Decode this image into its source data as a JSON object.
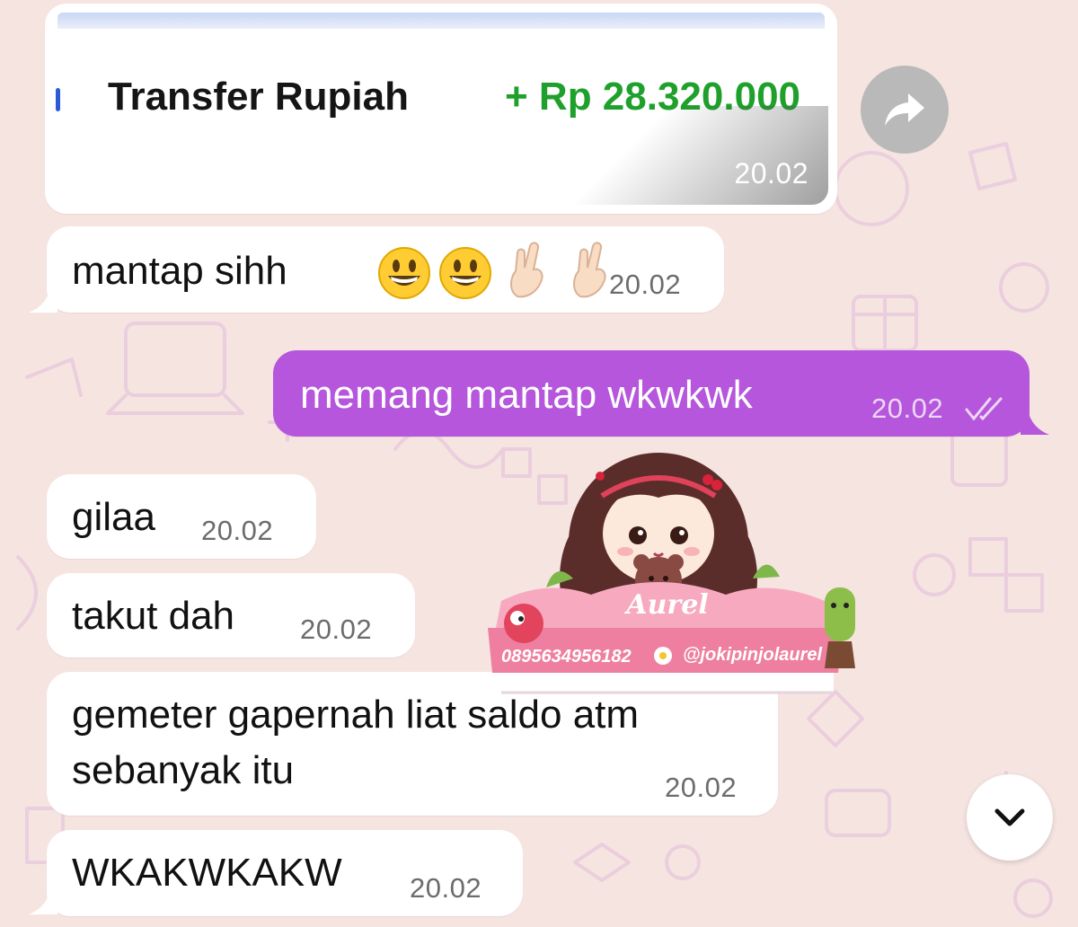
{
  "transfer_card": {
    "title": "Transfer Rupiah",
    "amount": "+ Rp 28.320.000",
    "time": "20.02",
    "amount_color": "#1fa02c"
  },
  "messages": [
    {
      "direction": "incoming",
      "text": "mantap sihh",
      "time": "20.02",
      "emojis": [
        "grinning-face",
        "grinning-face",
        "crossed-fingers",
        "crossed-fingers"
      ]
    },
    {
      "direction": "outgoing",
      "text": "memang mantap wkwkwk",
      "time": "20.02",
      "status": "read-double-check"
    },
    {
      "direction": "incoming",
      "text": "gilaa",
      "time": "20.02"
    },
    {
      "direction": "incoming",
      "text": "takut dah",
      "time": "20.02"
    },
    {
      "direction": "incoming",
      "text_line1": "gemeter gapernah liat saldo atm",
      "text_line2": "sebanyak itu",
      "time": "20.02"
    },
    {
      "direction": "incoming",
      "text": "WKAKWKAKW",
      "time": "20.02"
    }
  ],
  "watermark": {
    "name": "Aurel",
    "phone": "0895634956182",
    "handle": "@jokipinjolaurel"
  },
  "colors": {
    "background": "#f6e4e1",
    "outgoing_bubble": "#b556dc",
    "incoming_bubble": "#ffffff"
  },
  "icons": {
    "forward": "forward-arrow-icon",
    "scroll_down": "chevron-down-icon",
    "read_receipt": "double-check-icon"
  }
}
